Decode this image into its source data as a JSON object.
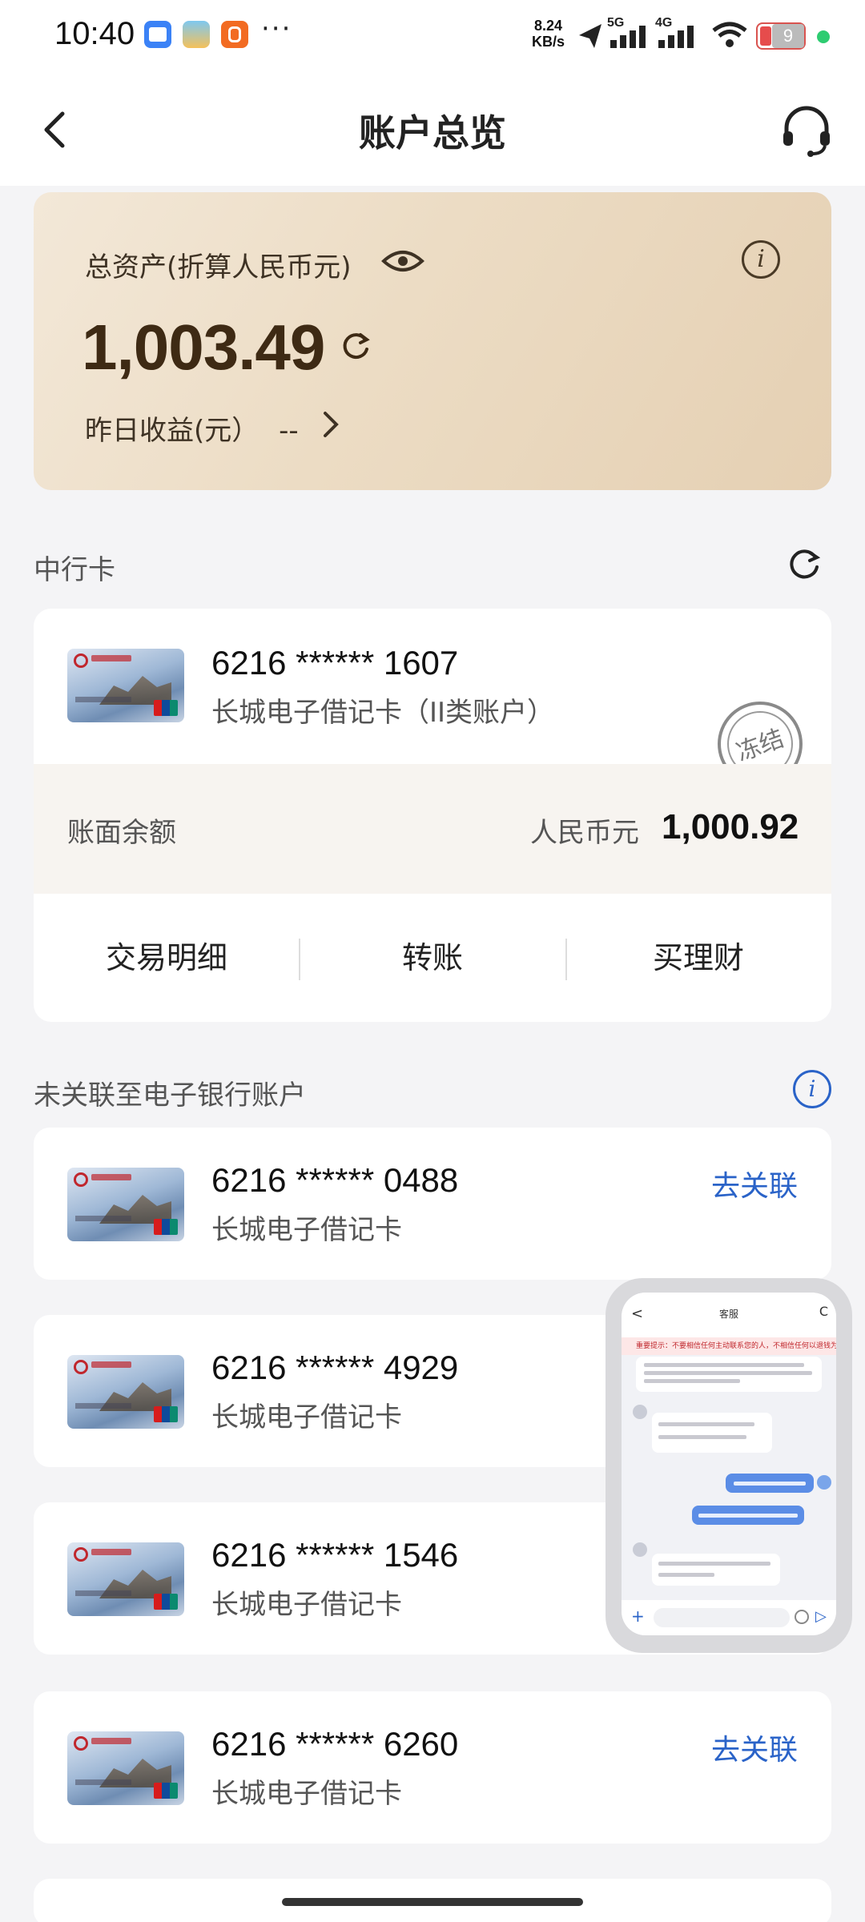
{
  "status_bar": {
    "time": "10:40",
    "more": "···",
    "net_speed_value": "8.24",
    "net_speed_unit": "KB/s",
    "signal_1_label": "5G",
    "signal_2_label": "4G",
    "battery": "9",
    "icons": [
      "calendar-app-icon",
      "photo-app-icon",
      "music-app-icon",
      "send-icon",
      "signal-icon",
      "wifi-icon",
      "battery-icon"
    ]
  },
  "header": {
    "title": "账户总览",
    "back_icon": "back-arrow-icon",
    "service_icon": "headset-icon"
  },
  "assets": {
    "label": "总资产(折算人民币元)",
    "amount": "1,003.49",
    "yesterday_label": "昨日收益(元）",
    "yesterday_value": "--",
    "info_glyph": "i"
  },
  "bank_section": {
    "title": "中行卡",
    "card_number": "6216 ****** 1607",
    "card_type": "长城电子借记卡（II类账户）",
    "stamp": "冻结",
    "balance_label": "账面余额",
    "currency": "人民币元",
    "balance": "1,000.92",
    "actions": [
      "交易明细",
      "转账",
      "买理财"
    ]
  },
  "unlinked_section": {
    "title": "未关联至电子银行账户",
    "info_glyph": "i",
    "link_label": "去关联",
    "cards": [
      {
        "number": "6216 ****** 0488",
        "type": "长城电子借记卡"
      },
      {
        "number": "6216 ****** 4929",
        "type": "长城电子借记卡"
      },
      {
        "number": "6216 ****** 1546",
        "type": "长城电子借记卡"
      },
      {
        "number": "6216 ****** 6260",
        "type": "长城电子借记卡"
      }
    ]
  },
  "floating_window": {
    "title": "客服",
    "back": "<",
    "refresh": "C",
    "notice": "重要提示：不要相信任何主动联系您的人，不相信任何以退钱为",
    "plus": "+",
    "send": "▷"
  },
  "colors": {
    "accent_blue": "#2a63c8",
    "asset_card_start": "#f3e8d8",
    "asset_card_end": "#e5d0b3",
    "balance_band": "#f7f4f0"
  }
}
